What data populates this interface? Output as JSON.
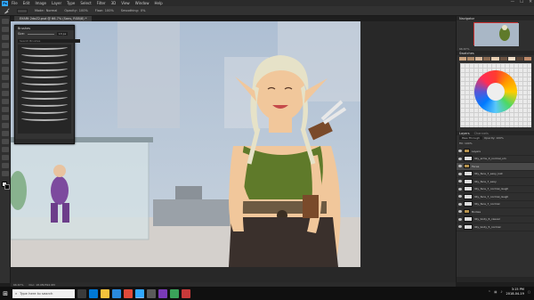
{
  "app": {
    "logo": "Ps",
    "menu": [
      "File",
      "Edit",
      "Image",
      "Layer",
      "Type",
      "Select",
      "Filter",
      "3D",
      "View",
      "Window",
      "Help"
    ],
    "window_controls": [
      "—",
      "☐",
      "✕"
    ]
  },
  "options_bar": {
    "mode_label": "Mode:",
    "mode_value": "Normal",
    "opacity_label": "Opacity:",
    "opacity_value": "100%",
    "flow_label": "Flow:",
    "flow_value": "100%",
    "smoothing_label": "Smoothing:",
    "smoothing_value": "0%"
  },
  "document": {
    "tab_title": "ElfARt 2doZ2.psd @ 66.7% (Sans, RGB/8) *"
  },
  "brushes_panel": {
    "title": "Brushes",
    "size_label": "Size:",
    "size_value": "13 px",
    "search_placeholder": "Search Brushes",
    "stroke_count": 11
  },
  "right_panels": {
    "navigator_tab": "Navigator",
    "navigator_zoom": "66.67%",
    "swatches_tab": "Swatches",
    "layers_tab": "Layers",
    "channels_tab": "Channels",
    "blend_mode": "Pass Through",
    "opacity_label": "Opacity: 100%",
    "fill_label": "Fill: 100%",
    "layers": [
      {
        "name": "Layers",
        "type": "group",
        "selected": false
      },
      {
        "name": "lilly_arms_it_normal_sm",
        "type": "layer",
        "selected": false
      },
      {
        "name": "Faces",
        "type": "group",
        "selected": true
      },
      {
        "name": "lilly_face_7_sexy_lost",
        "type": "layer",
        "selected": false
      },
      {
        "name": "lilly_face_7_sexy",
        "type": "layer",
        "selected": false
      },
      {
        "name": "lilly_face_7_normal_laugh",
        "type": "layer",
        "selected": false
      },
      {
        "name": "lilly_face_7_normal_laugh",
        "type": "layer",
        "selected": false
      },
      {
        "name": "lilly_face_7_normal",
        "type": "layer",
        "selected": false
      },
      {
        "name": "Bodies",
        "type": "group",
        "selected": false
      },
      {
        "name": "lilly_body_6_casual",
        "type": "layer",
        "selected": false
      },
      {
        "name": "lilly_body_5_normal",
        "type": "layer",
        "selected": false
      }
    ]
  },
  "status": {
    "zoom": "66.67%",
    "doc_size": "Doc: 18.0M/394.9M"
  },
  "taskbar": {
    "search_placeholder": "Type here to search",
    "time": "3:15 PM",
    "date": "2018-04-19"
  },
  "colors": {
    "ps_blue": "#31a8ff",
    "canvas_sky": "#b9c7d6",
    "elf_top": "#5f7a2a",
    "elf_hair": "#e6e2c8",
    "elf_skin": "#f1c79b"
  }
}
